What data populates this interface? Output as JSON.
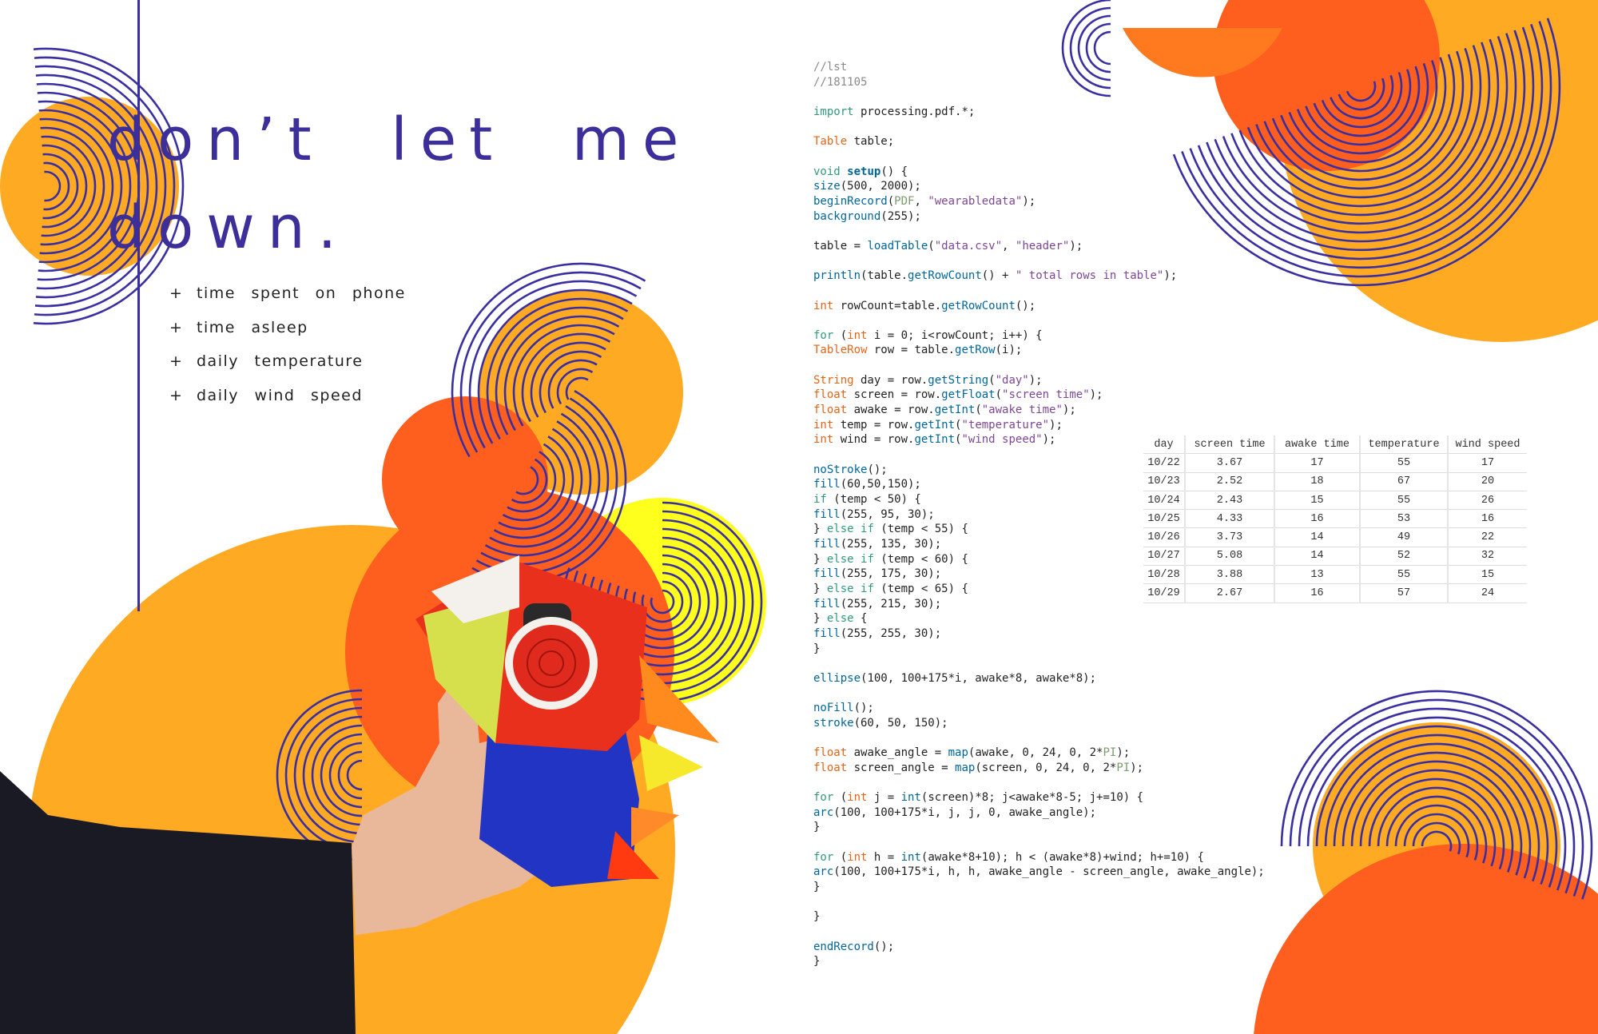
{
  "title": {
    "line1": "don’t let me",
    "line2": "down."
  },
  "bullets": [
    {
      "symbol": "+",
      "label": "time spent on phone"
    },
    {
      "symbol": "+",
      "label": "time asleep"
    },
    {
      "symbol": "+",
      "label": "daily temperature"
    },
    {
      "symbol": "+",
      "label": "daily wind speed"
    }
  ],
  "colors": {
    "indigo": "#3a2fa0",
    "orange": "#ffaa22",
    "red_orange": "#ff5f1e",
    "yellow": "#ffff1e"
  },
  "code_lines": [
    "{c://lst}",
    "{c://181105}",
    "",
    "{k:import} processing.pdf.*;",
    "",
    "{t:Table} table;",
    "",
    "{k:void} {b:setup}() {",
    "{f:size}(500, 2000);",
    "{f:beginRecord}({p:PDF}, {s:\"wearabledata\"});",
    "{f:background}(255);",
    "",
    "table = {f:loadTable}({s:\"data.csv\"}, {s:\"header\"});",
    "",
    "{f:println}(table.{f:getRowCount}() + {s:\" total rows in table\"});",
    "",
    "{t:int} rowCount=table.{f:getRowCount}();",
    "",
    "{k:for} ({t:int} i = 0; i<rowCount; i++) {",
    "{t:TableRow} row = table.{f:getRow}(i);",
    "",
    "{t:String} day = row.{f:getString}({s:\"day\"});",
    "{t:float} screen = row.{f:getFloat}({s:\"screen time\"});",
    "{t:float} awake = row.{f:getInt}({s:\"awake time\"});",
    "{t:int} temp = row.{f:getInt}({s:\"temperature\"});",
    "{t:int} wind = row.{f:getInt}({s:\"wind speed\"});",
    "",
    "{f:noStroke}();",
    "{f:fill}(60,50,150);",
    "{k:if} (temp < 50) {",
    "{f:fill}(255, 95, 30);",
    "} {k:else} {k:if} (temp < 55) {",
    "{f:fill}(255, 135, 30);",
    "} {k:else} {k:if} (temp < 60) {",
    "{f:fill}(255, 175, 30);",
    "} {k:else} {k:if} (temp < 65) {",
    "{f:fill}(255, 215, 30);",
    "} {k:else} {",
    "{f:fill}(255, 255, 30);",
    "}",
    "",
    "{f:ellipse}(100, 100+175*i, awake*8, awake*8);",
    "",
    "{f:noFill}();",
    "{f:stroke}(60, 50, 150);",
    "",
    "{t:float} awake_angle = {f:map}(awake, 0, 24, 0, 2*{p:PI});",
    "{t:float} screen_angle = {f:map}(screen, 0, 24, 0, 2*{p:PI});",
    "",
    "{k:for} ({t:int} j = {f:int}(screen)*8; j<awake*8-5; j+=10) {",
    "{f:arc}(100, 100+175*i, j, j, 0, awake_angle);",
    "}",
    "",
    "{k:for} ({t:int} h = {f:int}(awake*8+10); h < (awake*8)+wind; h+=10) {",
    "{f:arc}(100, 100+175*i, h, h, awake_angle - screen_angle, awake_angle);",
    "}",
    "",
    "}",
    "",
    "{f:endRecord}();",
    "}"
  ],
  "table": {
    "headers": [
      "day",
      "screen time",
      "awake time",
      "temperature",
      "wind speed"
    ],
    "rows": [
      [
        "10/22",
        "3.67",
        "17",
        "55",
        "17"
      ],
      [
        "10/23",
        "2.52",
        "18",
        "67",
        "20"
      ],
      [
        "10/24",
        "2.43",
        "15",
        "55",
        "26"
      ],
      [
        "10/25",
        "4.33",
        "16",
        "53",
        "16"
      ],
      [
        "10/26",
        "3.73",
        "14",
        "49",
        "22"
      ],
      [
        "10/27",
        "5.08",
        "14",
        "52",
        "32"
      ],
      [
        "10/28",
        "3.88",
        "13",
        "55",
        "15"
      ],
      [
        "10/29",
        "2.67",
        "16",
        "57",
        "24"
      ]
    ]
  }
}
